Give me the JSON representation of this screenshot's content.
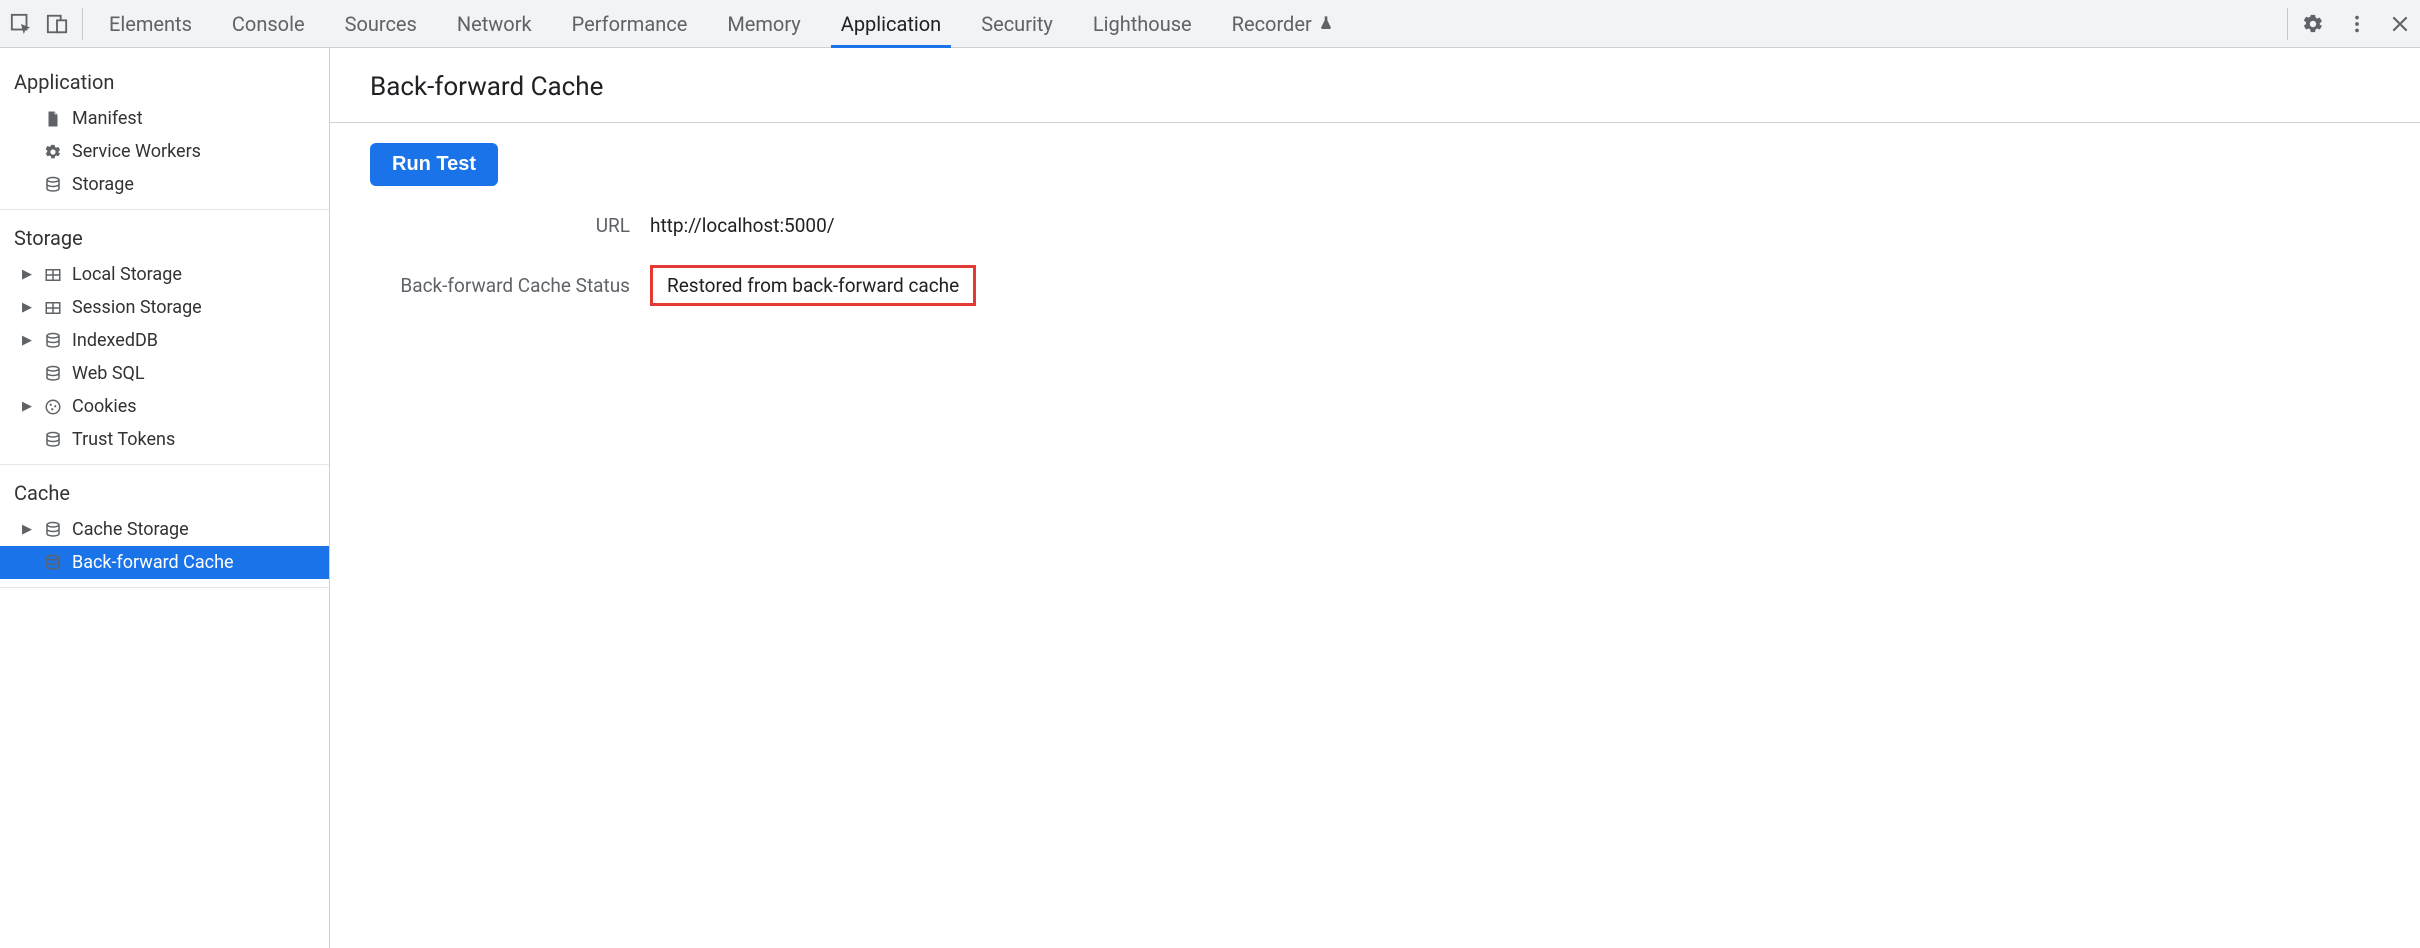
{
  "topbar": {
    "tabs": [
      {
        "label": "Elements",
        "active": false
      },
      {
        "label": "Console",
        "active": false
      },
      {
        "label": "Sources",
        "active": false
      },
      {
        "label": "Network",
        "active": false
      },
      {
        "label": "Performance",
        "active": false
      },
      {
        "label": "Memory",
        "active": false
      },
      {
        "label": "Application",
        "active": true
      },
      {
        "label": "Security",
        "active": false
      },
      {
        "label": "Lighthouse",
        "active": false
      },
      {
        "label": "Recorder",
        "active": false,
        "flask": true
      }
    ]
  },
  "sidebar": {
    "sections": [
      {
        "title": "Application",
        "items": [
          {
            "label": "Manifest",
            "icon": "file",
            "expandable": false
          },
          {
            "label": "Service Workers",
            "icon": "gear",
            "expandable": false
          },
          {
            "label": "Storage",
            "icon": "db",
            "expandable": false
          }
        ]
      },
      {
        "title": "Storage",
        "items": [
          {
            "label": "Local Storage",
            "icon": "grid",
            "expandable": true
          },
          {
            "label": "Session Storage",
            "icon": "grid",
            "expandable": true
          },
          {
            "label": "IndexedDB",
            "icon": "db",
            "expandable": true
          },
          {
            "label": "Web SQL",
            "icon": "db",
            "expandable": false
          },
          {
            "label": "Cookies",
            "icon": "cookie",
            "expandable": true
          },
          {
            "label": "Trust Tokens",
            "icon": "db",
            "expandable": false
          }
        ]
      },
      {
        "title": "Cache",
        "items": [
          {
            "label": "Cache Storage",
            "icon": "db",
            "expandable": true
          },
          {
            "label": "Back-forward Cache",
            "icon": "db",
            "expandable": false,
            "selected": true
          }
        ]
      }
    ]
  },
  "main": {
    "title": "Back-forward Cache",
    "runButton": "Run Test",
    "rows": [
      {
        "label": "URL",
        "value": "http://localhost:5000/",
        "highlight": false
      },
      {
        "label": "Back-forward Cache Status",
        "value": "Restored from back-forward cache",
        "highlight": true
      }
    ]
  }
}
